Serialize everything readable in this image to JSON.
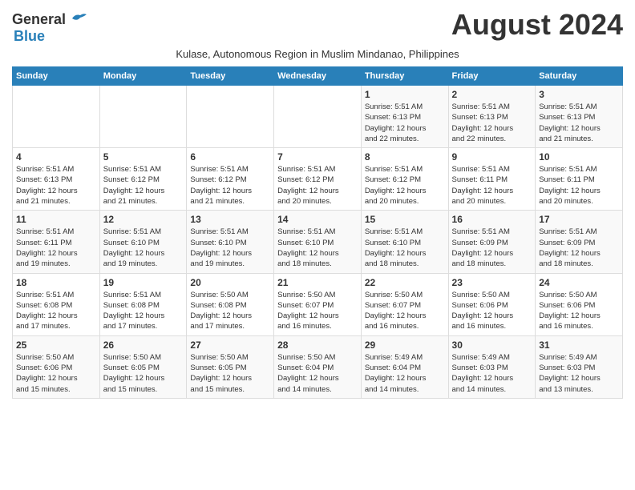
{
  "header": {
    "logo_line1": "General",
    "logo_line2": "Blue",
    "month_year": "August 2024",
    "subtitle": "Kulase, Autonomous Region in Muslim Mindanao, Philippines"
  },
  "weekdays": [
    "Sunday",
    "Monday",
    "Tuesday",
    "Wednesday",
    "Thursday",
    "Friday",
    "Saturday"
  ],
  "weeks": [
    [
      {
        "day": "",
        "info": ""
      },
      {
        "day": "",
        "info": ""
      },
      {
        "day": "",
        "info": ""
      },
      {
        "day": "",
        "info": ""
      },
      {
        "day": "1",
        "info": "Sunrise: 5:51 AM\nSunset: 6:13 PM\nDaylight: 12 hours\nand 22 minutes."
      },
      {
        "day": "2",
        "info": "Sunrise: 5:51 AM\nSunset: 6:13 PM\nDaylight: 12 hours\nand 22 minutes."
      },
      {
        "day": "3",
        "info": "Sunrise: 5:51 AM\nSunset: 6:13 PM\nDaylight: 12 hours\nand 21 minutes."
      }
    ],
    [
      {
        "day": "4",
        "info": "Sunrise: 5:51 AM\nSunset: 6:13 PM\nDaylight: 12 hours\nand 21 minutes."
      },
      {
        "day": "5",
        "info": "Sunrise: 5:51 AM\nSunset: 6:12 PM\nDaylight: 12 hours\nand 21 minutes."
      },
      {
        "day": "6",
        "info": "Sunrise: 5:51 AM\nSunset: 6:12 PM\nDaylight: 12 hours\nand 21 minutes."
      },
      {
        "day": "7",
        "info": "Sunrise: 5:51 AM\nSunset: 6:12 PM\nDaylight: 12 hours\nand 20 minutes."
      },
      {
        "day": "8",
        "info": "Sunrise: 5:51 AM\nSunset: 6:12 PM\nDaylight: 12 hours\nand 20 minutes."
      },
      {
        "day": "9",
        "info": "Sunrise: 5:51 AM\nSunset: 6:11 PM\nDaylight: 12 hours\nand 20 minutes."
      },
      {
        "day": "10",
        "info": "Sunrise: 5:51 AM\nSunset: 6:11 PM\nDaylight: 12 hours\nand 20 minutes."
      }
    ],
    [
      {
        "day": "11",
        "info": "Sunrise: 5:51 AM\nSunset: 6:11 PM\nDaylight: 12 hours\nand 19 minutes."
      },
      {
        "day": "12",
        "info": "Sunrise: 5:51 AM\nSunset: 6:10 PM\nDaylight: 12 hours\nand 19 minutes."
      },
      {
        "day": "13",
        "info": "Sunrise: 5:51 AM\nSunset: 6:10 PM\nDaylight: 12 hours\nand 19 minutes."
      },
      {
        "day": "14",
        "info": "Sunrise: 5:51 AM\nSunset: 6:10 PM\nDaylight: 12 hours\nand 18 minutes."
      },
      {
        "day": "15",
        "info": "Sunrise: 5:51 AM\nSunset: 6:10 PM\nDaylight: 12 hours\nand 18 minutes."
      },
      {
        "day": "16",
        "info": "Sunrise: 5:51 AM\nSunset: 6:09 PM\nDaylight: 12 hours\nand 18 minutes."
      },
      {
        "day": "17",
        "info": "Sunrise: 5:51 AM\nSunset: 6:09 PM\nDaylight: 12 hours\nand 18 minutes."
      }
    ],
    [
      {
        "day": "18",
        "info": "Sunrise: 5:51 AM\nSunset: 6:08 PM\nDaylight: 12 hours\nand 17 minutes."
      },
      {
        "day": "19",
        "info": "Sunrise: 5:51 AM\nSunset: 6:08 PM\nDaylight: 12 hours\nand 17 minutes."
      },
      {
        "day": "20",
        "info": "Sunrise: 5:50 AM\nSunset: 6:08 PM\nDaylight: 12 hours\nand 17 minutes."
      },
      {
        "day": "21",
        "info": "Sunrise: 5:50 AM\nSunset: 6:07 PM\nDaylight: 12 hours\nand 16 minutes."
      },
      {
        "day": "22",
        "info": "Sunrise: 5:50 AM\nSunset: 6:07 PM\nDaylight: 12 hours\nand 16 minutes."
      },
      {
        "day": "23",
        "info": "Sunrise: 5:50 AM\nSunset: 6:06 PM\nDaylight: 12 hours\nand 16 minutes."
      },
      {
        "day": "24",
        "info": "Sunrise: 5:50 AM\nSunset: 6:06 PM\nDaylight: 12 hours\nand 16 minutes."
      }
    ],
    [
      {
        "day": "25",
        "info": "Sunrise: 5:50 AM\nSunset: 6:06 PM\nDaylight: 12 hours\nand 15 minutes."
      },
      {
        "day": "26",
        "info": "Sunrise: 5:50 AM\nSunset: 6:05 PM\nDaylight: 12 hours\nand 15 minutes."
      },
      {
        "day": "27",
        "info": "Sunrise: 5:50 AM\nSunset: 6:05 PM\nDaylight: 12 hours\nand 15 minutes."
      },
      {
        "day": "28",
        "info": "Sunrise: 5:50 AM\nSunset: 6:04 PM\nDaylight: 12 hours\nand 14 minutes."
      },
      {
        "day": "29",
        "info": "Sunrise: 5:49 AM\nSunset: 6:04 PM\nDaylight: 12 hours\nand 14 minutes."
      },
      {
        "day": "30",
        "info": "Sunrise: 5:49 AM\nSunset: 6:03 PM\nDaylight: 12 hours\nand 14 minutes."
      },
      {
        "day": "31",
        "info": "Sunrise: 5:49 AM\nSunset: 6:03 PM\nDaylight: 12 hours\nand 13 minutes."
      }
    ]
  ]
}
